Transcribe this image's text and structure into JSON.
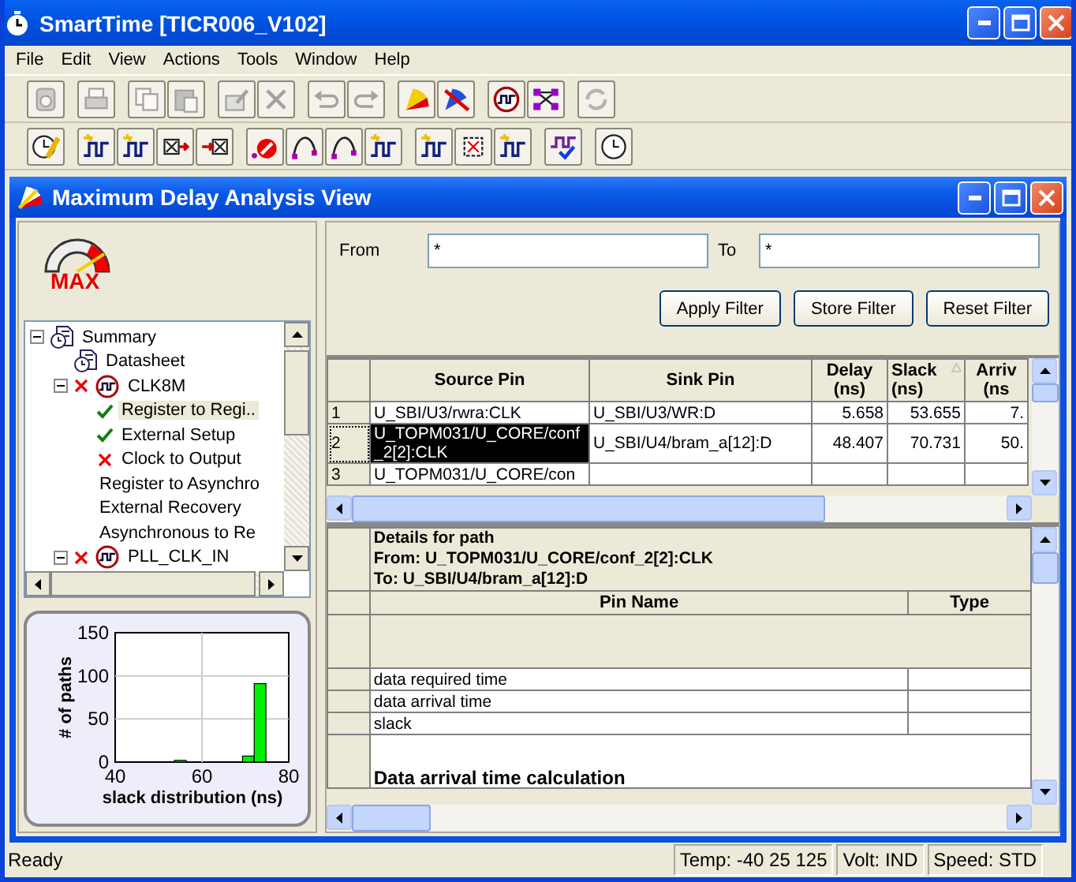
{
  "window": {
    "title": "SmartTime [TICR006_V102]"
  },
  "menu": [
    "File",
    "Edit",
    "View",
    "Actions",
    "Tools",
    "Window",
    "Help"
  ],
  "toolbar_rows": [
    {
      "groups": [
        [
          {
            "disabled": true
          }
        ],
        [
          {
            "disabled": true
          }
        ],
        [
          {
            "disabled": true
          },
          {
            "disabled": true
          }
        ],
        [
          {
            "disabled": true
          },
          {
            "disabled": true
          }
        ],
        [
          {
            "disabled": true
          },
          {
            "disabled": true
          }
        ],
        [
          {
            "disabled": false
          },
          {
            "disabled": false
          }
        ],
        [
          {
            "disabled": false
          },
          {
            "disabled": false
          }
        ],
        [
          {
            "disabled": true
          }
        ]
      ]
    },
    {
      "groups": [
        [
          {
            "disabled": false
          }
        ],
        [
          {
            "disabled": false
          },
          {
            "disabled": false
          },
          {
            "disabled": false
          },
          {
            "disabled": false
          }
        ],
        [
          {
            "disabled": false
          },
          {
            "disabled": false
          },
          {
            "disabled": false
          },
          {
            "disabled": false
          }
        ],
        [
          {
            "disabled": false
          },
          {
            "disabled": false
          },
          {
            "disabled": false
          }
        ],
        [
          {
            "disabled": false
          }
        ],
        [
          {
            "disabled": false
          }
        ]
      ]
    }
  ],
  "analysis_view": {
    "title": "Maximum Delay Analysis View",
    "logo_label": "MAX",
    "tree": [
      {
        "label": "Summary",
        "kind": "report",
        "expanded": true,
        "selected": false,
        "children": [
          {
            "label": "Datasheet",
            "kind": "report",
            "failed": false,
            "selected": false
          },
          {
            "label": "CLK8M",
            "kind": "clock",
            "failed": true,
            "expanded": true,
            "selected": false,
            "children": [
              {
                "label": "Register to Regi..",
                "kind": "pass",
                "selected": true
              },
              {
                "label": "External Setup",
                "kind": "pass",
                "selected": false
              },
              {
                "label": "Clock to Output",
                "kind": "fail",
                "selected": false
              },
              {
                "label": "Register to Asynchro",
                "kind": "plain",
                "selected": false
              },
              {
                "label": "External Recovery",
                "kind": "plain",
                "selected": false
              },
              {
                "label": "Asynchronous to Re",
                "kind": "plain",
                "selected": false
              }
            ]
          },
          {
            "label": "PLL_CLK_IN",
            "kind": "clock",
            "failed": true,
            "expanded": true,
            "selected": false
          }
        ]
      }
    ],
    "histogram": {
      "chart_data": {
        "type": "bar",
        "xlabel": "slack distribution (ns)",
        "ylabel": "# of paths",
        "x": [
          55,
          70.7,
          73.4
        ],
        "values": [
          2,
          7,
          91
        ],
        "xlim": [
          40,
          80
        ],
        "ylim": [
          0,
          150
        ],
        "xticks": [
          40,
          60,
          80
        ],
        "yticks": [
          0,
          50,
          100,
          150
        ],
        "grid": true
      }
    },
    "filter": {
      "from_label": "From",
      "from_value": "*",
      "to_label": "To",
      "to_value": "*",
      "buttons": [
        "Apply Filter",
        "Store Filter",
        "Reset Filter"
      ]
    },
    "paths_table": {
      "columns": [
        {
          "label": "Source Pin",
          "sorted": false
        },
        {
          "label": "Sink Pin",
          "sorted": false
        },
        {
          "label": "Delay (ns)",
          "sorted": false
        },
        {
          "label": "Slack (ns)",
          "sorted": true
        },
        {
          "label": "Arriv (ns",
          "sorted": false
        }
      ],
      "rows": [
        {
          "number": "1",
          "selected": false,
          "cells": [
            "U_SBI/U3/rwra:CLK",
            "U_SBI/U3/WR:D",
            "5.658",
            "53.655",
            "7."
          ]
        },
        {
          "number": "2",
          "selected": true,
          "cells": [
            "U_TOPM031/U_CORE/conf_2[2]:CLK",
            "U_SBI/U4/bram_a[12]:D",
            "48.407",
            "70.731",
            "50."
          ]
        },
        {
          "number": "3",
          "selected": false,
          "cells": [
            "U_TOPM031/U_CORE/con"
          ]
        }
      ]
    },
    "path_details": {
      "title_lines": [
        "Details for path",
        "From: U_TOPM031/U_CORE/conf_2[2]:CLK",
        "To: U_SBI/U4/bram_a[12]:D"
      ],
      "columns": [
        "Pin Name",
        "Type"
      ],
      "rows": [
        {
          "kind": "spacer"
        },
        {
          "kind": "row",
          "pin_name": "data required time"
        },
        {
          "kind": "row",
          "pin_name": "data arrival time"
        },
        {
          "kind": "row",
          "pin_name": "slack"
        },
        {
          "kind": "section",
          "title": "Data arrival time calculation"
        }
      ]
    }
  },
  "status_bar": {
    "message": "Ready",
    "panes": [
      "Temp: -40 25 125",
      "Volt: IND",
      "Speed: STD"
    ]
  }
}
